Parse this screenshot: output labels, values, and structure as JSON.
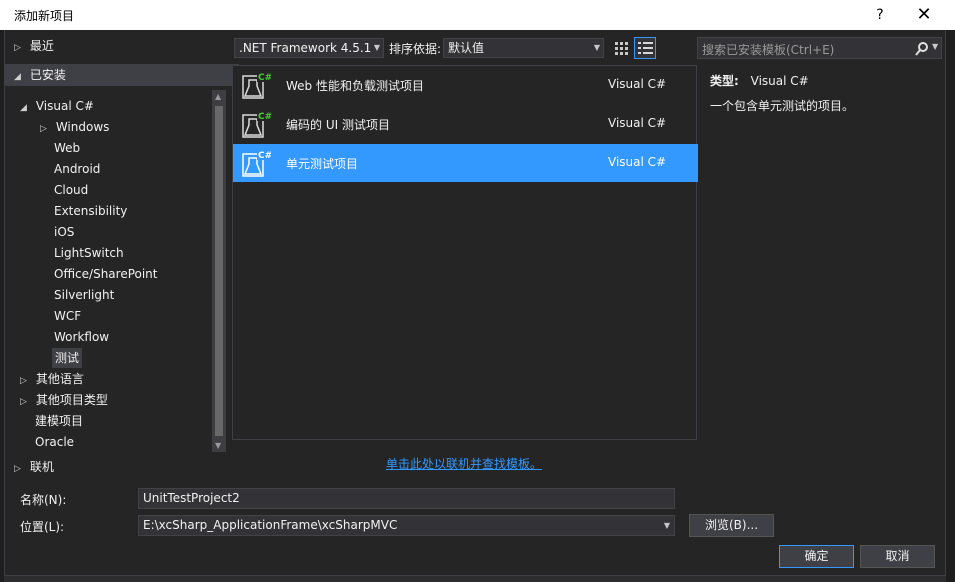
{
  "window": {
    "title": "添加新项目",
    "help": "?",
    "close": "✕"
  },
  "tree": {
    "recent": "最近",
    "installed": "已安装",
    "visual_csharp": "Visual C#",
    "children": [
      "Windows",
      "Web",
      "Android",
      "Cloud",
      "Extensibility",
      "iOS",
      "LightSwitch",
      "Office/SharePoint",
      "Silverlight",
      "WCF",
      "Workflow",
      "测试"
    ],
    "other_languages": "其他语言",
    "other_project_types": "其他项目类型",
    "modeling_projects": "建模项目",
    "oracle": "Oracle",
    "online": "联机"
  },
  "toolbar": {
    "framework": ".NET Framework 4.5.1",
    "sort_label": "排序依据:",
    "sort_value": "默认值"
  },
  "search": {
    "placeholder": "搜索已安装模板(Ctrl+E)"
  },
  "templates": [
    {
      "name": "Web 性能和负载测试项目",
      "lang": "Visual C#"
    },
    {
      "name": "编码的 UI 测试项目",
      "lang": "Visual C#"
    },
    {
      "name": "单元测试项目",
      "lang": "Visual C#"
    }
  ],
  "details": {
    "type_label": "类型:",
    "type_value": "Visual C#",
    "description": "一个包含单元测试的项目。"
  },
  "online_link": "单击此处以联机并查找模板。",
  "form": {
    "name_label": "名称(N):",
    "name_value": "UnitTestProject2",
    "location_label": "位置(L):",
    "location_value": "E:\\xcSharp_ApplicationFrame\\xcSharpMVC",
    "browse": "浏览(B)...",
    "ok": "确定",
    "cancel": "取消"
  },
  "colors": {
    "accent": "#3399ff",
    "background": "#252526",
    "chrome": "#2d2d30"
  },
  "icons": [
    "chevron-right-icon",
    "triangle-down-icon",
    "flask-csharp-icon",
    "search-icon",
    "grid-view-icon",
    "list-view-icon"
  ]
}
